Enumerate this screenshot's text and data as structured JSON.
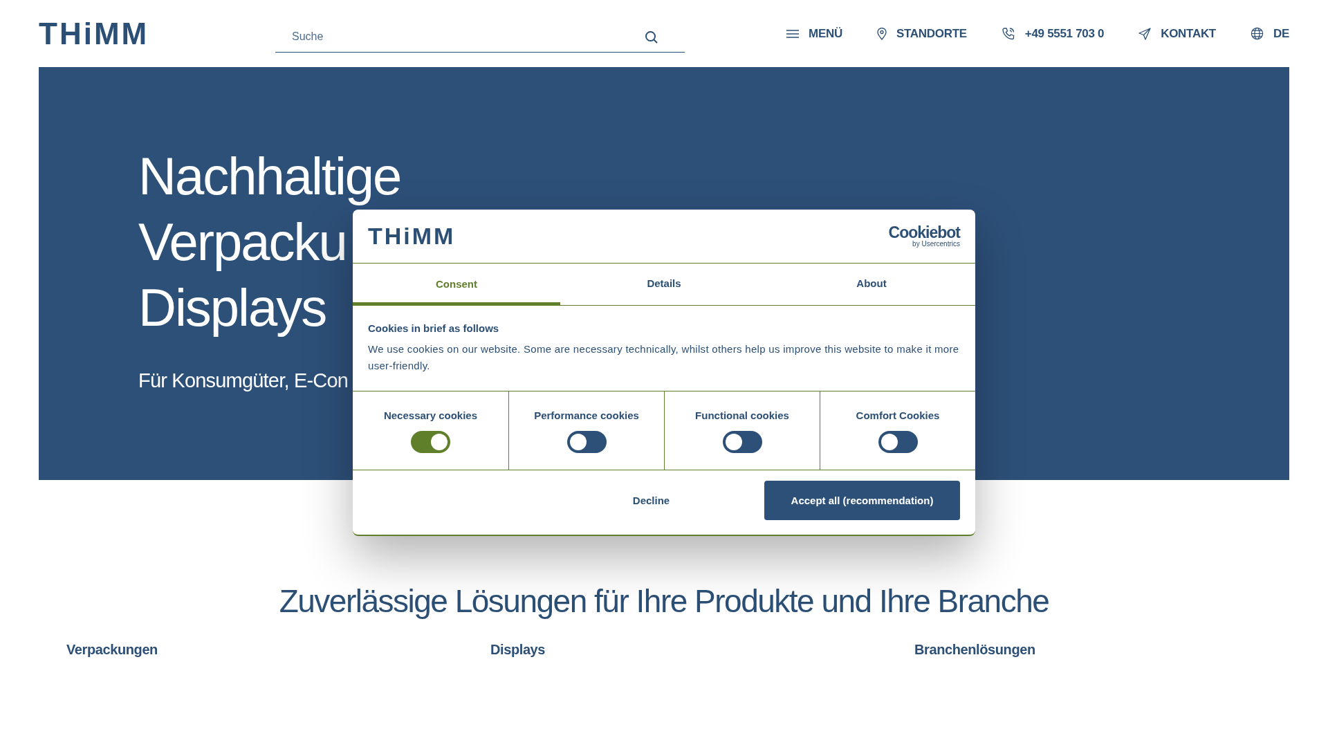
{
  "header": {
    "logo": "THiMM",
    "search": {
      "placeholder": "Suche"
    },
    "nav": [
      {
        "kind": "menu",
        "label": "MENÜ"
      },
      {
        "kind": "pin",
        "label": "STANDORTE"
      },
      {
        "kind": "phone",
        "label": "+49 5551 703 0"
      },
      {
        "kind": "send",
        "label": "KONTAKT"
      },
      {
        "kind": "globe",
        "label": "DE"
      }
    ]
  },
  "hero": {
    "title_lines": [
      "Nachhaltige",
      "Verpacku",
      "Displays"
    ],
    "subtitle": "Für Konsumgüter, E-Con"
  },
  "section": {
    "title": "Zuverlässige Lösungen für Ihre Produkte und Ihre Branche",
    "categories": [
      "Verpackungen",
      "Displays",
      "Branchenlösungen"
    ]
  },
  "cookie_dialog": {
    "logo": "THiMM",
    "provider": "Cookiebot",
    "provider_sub": "by Usercentrics",
    "tabs": [
      {
        "label": "Consent",
        "selected": true
      },
      {
        "label": "Details",
        "selected": false
      },
      {
        "label": "About",
        "selected": false
      }
    ],
    "heading": "Cookies in brief as follows",
    "text": "We use cookies on our website. Some are necessary technically, whilst others help us improve this website to make it more user-friendly.",
    "toggles": [
      {
        "label": "Necessary cookies",
        "checked": true
      },
      {
        "label": "Performance cookies",
        "checked": false
      },
      {
        "label": "Functional cookies",
        "checked": false
      },
      {
        "label": "Comfort Cookies",
        "checked": false
      }
    ],
    "buttons": [
      {
        "kind": "secondary",
        "label": "Decline"
      },
      {
        "kind": "primary",
        "label": "Accept all (recommendation)"
      }
    ]
  }
}
